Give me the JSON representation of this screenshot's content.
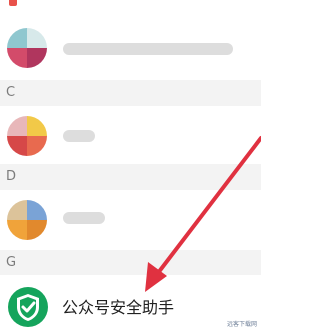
{
  "contacts": {
    "sections": {
      "c": "C",
      "d": "D",
      "g": "G"
    },
    "assistant": {
      "label": "公众号安全助手",
      "icon": "shield-check-icon",
      "icon_color": "#15a45c"
    }
  },
  "watermark": {
    "text": "远客下载网"
  },
  "colors": {
    "arrow": "#e03140",
    "section_bg": "#f3f3f3",
    "section_text": "#7b7b7b"
  }
}
